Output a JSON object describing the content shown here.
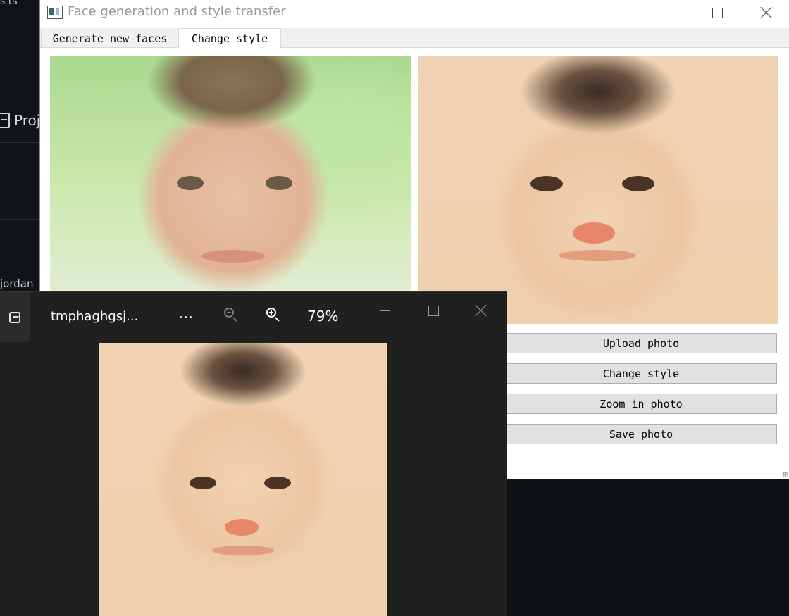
{
  "background_app": {
    "top_text": "s    ts",
    "project_label": "Proj",
    "user_label": "jordan"
  },
  "main_window": {
    "title": "Face generation and style transfer",
    "tabs": [
      {
        "label": "Generate new faces",
        "active": false
      },
      {
        "label": "Change style",
        "active": true
      }
    ],
    "buttons": {
      "upload": "Upload photo",
      "change_style": "Change style",
      "zoom_in": "Zoom in photo",
      "save": "Save photo"
    }
  },
  "viewer": {
    "filename": "tmphaghgsj...",
    "zoom_level": "79%",
    "icons": {
      "app": "image-icon",
      "more": "more-icon",
      "zoom_out": "zoom-out-icon",
      "zoom_in": "zoom-in-icon"
    }
  },
  "colors": {
    "viewer_bg": "#202020",
    "qt_button": "#e1e1e1",
    "desktop_bg": "#0e1116"
  }
}
